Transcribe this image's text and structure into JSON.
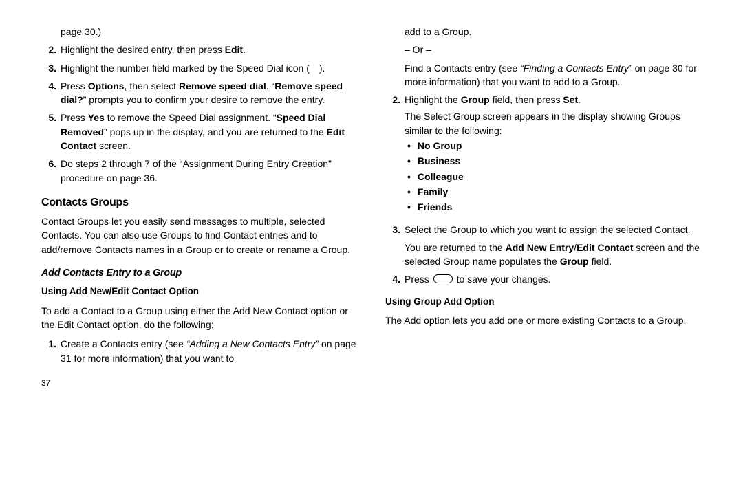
{
  "left": {
    "cont_line": "page 30.)",
    "step2": {
      "pre": "Highlight the desired entry, then press ",
      "bold": "Edit",
      "post": "."
    },
    "step3": "Highlight the number field marked by the Speed Dial icon (  ).",
    "step4": {
      "t1": "Press ",
      "b1": "Options",
      "t2": ", then select ",
      "b2": "Remove speed dial",
      "t3": ". “",
      "b3": "Remove speed dial?",
      "t4": "” prompts you to confirm your desire to remove the entry."
    },
    "step5": {
      "t1": "Press ",
      "b1": "Yes",
      "t2": " to remove the Speed Dial assignment. “",
      "b2": "Speed Dial Removed",
      "t3": "” pops up in the display, and you are returned to the ",
      "b3": "Edit Contact",
      "t4": " screen."
    },
    "step6": "Do steps 2 through 7 of the “Assignment During Entry Creation” procedure on page 36.",
    "section": "Contacts Groups",
    "section_body": "Contact Groups let you easily send messages to multiple, selected Contacts. You can also use Groups to find Contact entries and to add/remove Contacts names in a Group or to create or rename a Group.",
    "subsection": "Add Contacts Entry to a Group",
    "subsub": "Using Add New/Edit Contact Option",
    "subsub_body": "To add a Contact to a Group using either the Add New Contact option or the Edit Contact option, do the following:",
    "step1b": {
      "t1": "Create a Contacts entry (see ",
      "it": "“Adding a New Contacts Entry”",
      "t2": " on page 31 for more information) that you want to"
    },
    "page_num": "37"
  },
  "right": {
    "cont1": "add to a Group.",
    "or": "– Or –",
    "cont2a": "Find a Contacts entry (see ",
    "cont2it": "“Finding a Contacts Entry”",
    "cont2b": " on page 30 for more information) that you want to add to a Group.",
    "step2": {
      "t1": "Highlight the ",
      "b1": "Group",
      "t2": " field, then press ",
      "b2": "Set",
      "t3": "."
    },
    "step2_body": "The Select Group screen appears in the display showing Groups similar to the following:",
    "groups": [
      "No Group",
      "Business",
      "Colleague",
      "Family",
      "Friends"
    ],
    "step3a": "Select the Group to which you want to assign the selected Contact.",
    "step3b": {
      "t1": "You are returned to the ",
      "b1": "Add New Entry",
      "t1b": "/",
      "b2": "Edit Contact",
      "t2": " screen and the selected Group name populates the ",
      "b3": "Group",
      "t3": " field."
    },
    "step4": {
      "t1": "Press ",
      "t2": " to save your changes."
    },
    "subsub2": "Using Group Add Option",
    "subsub2_body": "The Add option lets you add one or more existing Contacts to a Group."
  }
}
